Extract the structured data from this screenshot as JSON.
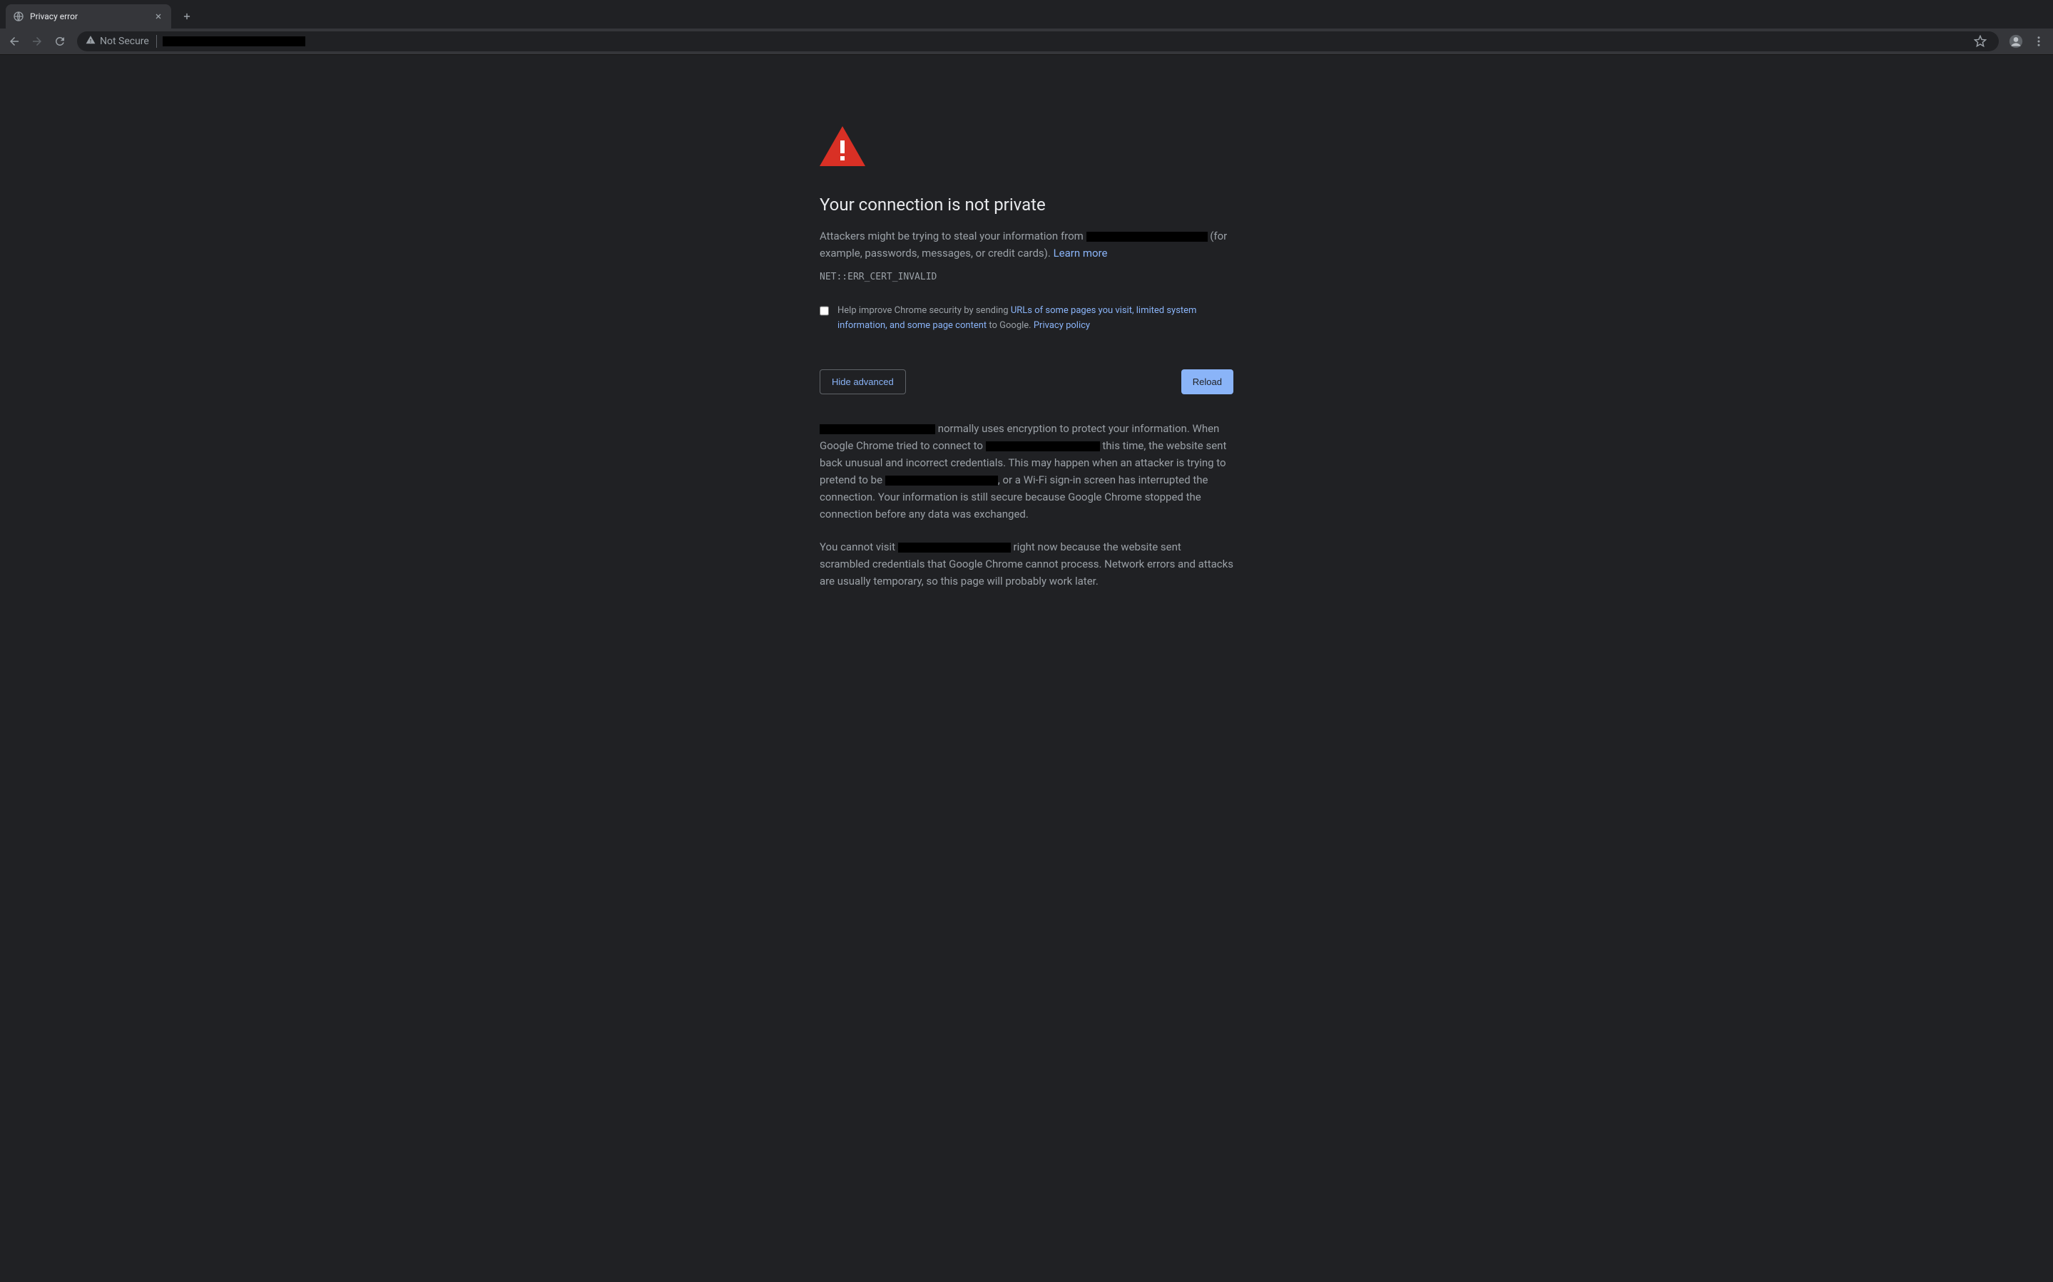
{
  "tab": {
    "title": "Privacy error"
  },
  "toolbar": {
    "security_label": "Not Secure"
  },
  "page": {
    "heading": "Your connection is not private",
    "attackers_prefix": "Attackers might be trying to steal your information from ",
    "attackers_suffix": " (for example, passwords, messages, or credit cards). ",
    "learn_more": "Learn more",
    "error_code": "NET::ERR_CERT_INVALID",
    "optin_prefix": "Help improve Chrome security by sending ",
    "optin_link": "URLs of some pages you visit, limited system information, and some page content",
    "optin_mid": " to Google. ",
    "privacy_policy": "Privacy policy",
    "hide_advanced": "Hide advanced",
    "reload": "Reload",
    "adv1_a": " normally uses encryption to protect your information. When Google Chrome tried to connect to ",
    "adv1_b": " this time, the website sent back unusual and incorrect credentials. This may happen when an attacker is trying to pretend to be ",
    "adv1_c": ", or a Wi-Fi sign-in screen has interrupted the connection. Your information is still secure because Google Chrome stopped the connection before any data was exchanged.",
    "adv2_a": "You cannot visit ",
    "adv2_b": " right now because the website sent scrambled credentials that Google Chrome cannot process. Network errors and attacks are usually temporary, so this page will probably work later."
  }
}
